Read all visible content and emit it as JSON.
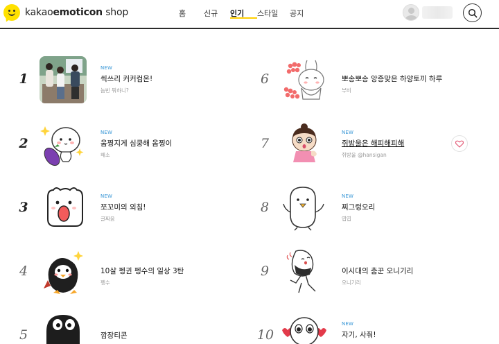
{
  "header": {
    "logo_prefix": "kakao",
    "logo_strong": "emoticon",
    "logo_suffix": " shop",
    "nav": [
      "홈",
      "신규",
      "인기",
      "스타일",
      "공지"
    ],
    "active_nav": "인기",
    "icons": {
      "search": "search-icon",
      "avatar": "user-avatar-icon",
      "logo": "kakao-smile-logo"
    },
    "accent_color": "#ffcf00"
  },
  "ranking": [
    {
      "rank": "1",
      "is_new": true,
      "new_label": "NEW",
      "title": "씩쓰리 커커컴온!",
      "author": "놈빈 뭐하니?"
    },
    {
      "rank": "2",
      "is_new": true,
      "new_label": "NEW",
      "title": "움찡지게 심쿵해 옴찡이",
      "author": "해소"
    },
    {
      "rank": "3",
      "is_new": true,
      "new_label": "NEW",
      "title": "쪼꼬미의 외침!",
      "author": "글짜음"
    },
    {
      "rank": "4",
      "is_new": false,
      "new_label": "",
      "title": "10살 펭귄 펭수의 일상 3탄",
      "author": "펭수"
    },
    {
      "rank": "5",
      "is_new": false,
      "new_label": "",
      "title": "깜장티콘",
      "author": ""
    },
    {
      "rank": "6",
      "is_new": false,
      "new_label": "",
      "title": "뽀송뽀송 앙증맞은 하양토끼 하루",
      "author": "부비"
    },
    {
      "rank": "7",
      "is_new": true,
      "new_label": "NEW",
      "title": "쥐방울은 해피해피해",
      "author": "쥐방울 @hansigan"
    },
    {
      "rank": "8",
      "is_new": true,
      "new_label": "NEW",
      "title": "찌그렁오리",
      "author": "엽엽"
    },
    {
      "rank": "9",
      "is_new": false,
      "new_label": "",
      "title": "이시대의 춤꾼 오니기리",
      "author": "오니기리"
    },
    {
      "rank": "10",
      "is_new": true,
      "new_label": "NEW",
      "title": "자기, 사줘!",
      "author": ""
    }
  ]
}
